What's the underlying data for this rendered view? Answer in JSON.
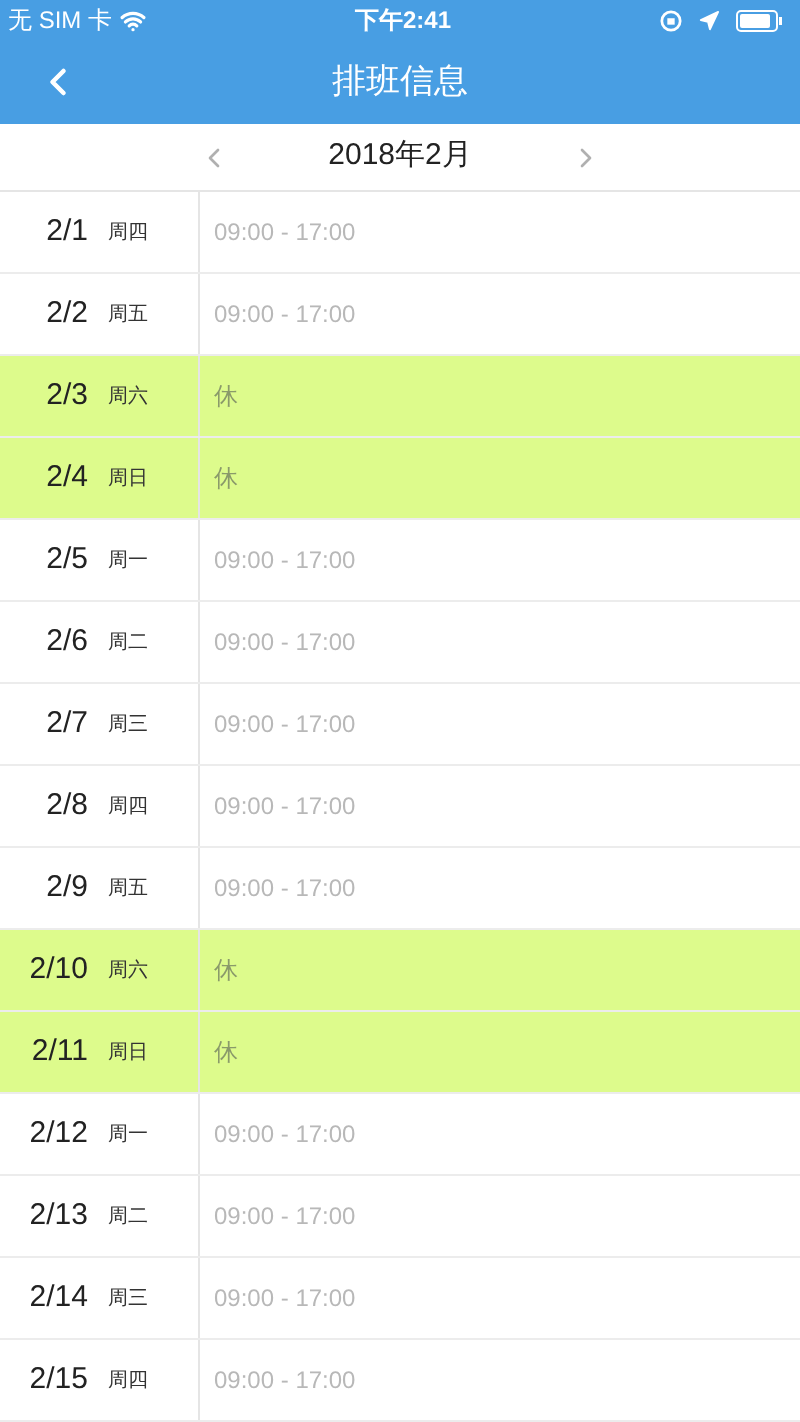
{
  "status_bar": {
    "carrier": "无 SIM 卡",
    "time": "下午2:41"
  },
  "nav": {
    "title": "排班信息"
  },
  "month": {
    "label": "2018年2月"
  },
  "rows": [
    {
      "date": "2/1",
      "weekday": "周四",
      "shift": "09:00 - 17:00",
      "kind": "work"
    },
    {
      "date": "2/2",
      "weekday": "周五",
      "shift": "09:00 - 17:00",
      "kind": "work"
    },
    {
      "date": "2/3",
      "weekday": "周六",
      "shift": "休",
      "kind": "off"
    },
    {
      "date": "2/4",
      "weekday": "周日",
      "shift": "休",
      "kind": "off"
    },
    {
      "date": "2/5",
      "weekday": "周一",
      "shift": "09:00 - 17:00",
      "kind": "work"
    },
    {
      "date": "2/6",
      "weekday": "周二",
      "shift": "09:00 - 17:00",
      "kind": "work"
    },
    {
      "date": "2/7",
      "weekday": "周三",
      "shift": "09:00 - 17:00",
      "kind": "work"
    },
    {
      "date": "2/8",
      "weekday": "周四",
      "shift": "09:00 - 17:00",
      "kind": "work"
    },
    {
      "date": "2/9",
      "weekday": "周五",
      "shift": "09:00 - 17:00",
      "kind": "work"
    },
    {
      "date": "2/10",
      "weekday": "周六",
      "shift": "休",
      "kind": "off"
    },
    {
      "date": "2/11",
      "weekday": "周日",
      "shift": "休",
      "kind": "off"
    },
    {
      "date": "2/12",
      "weekday": "周一",
      "shift": "09:00 - 17:00",
      "kind": "work"
    },
    {
      "date": "2/13",
      "weekday": "周二",
      "shift": "09:00 - 17:00",
      "kind": "work"
    },
    {
      "date": "2/14",
      "weekday": "周三",
      "shift": "09:00 - 17:00",
      "kind": "work"
    },
    {
      "date": "2/15",
      "weekday": "周四",
      "shift": "09:00 - 17:00",
      "kind": "work"
    }
  ]
}
